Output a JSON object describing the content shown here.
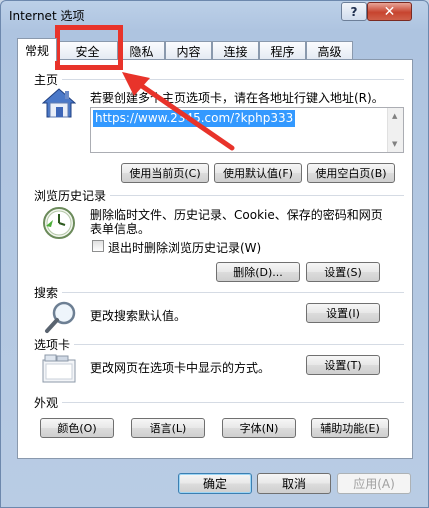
{
  "window": {
    "title": "Internet 选项",
    "help_label": "?",
    "close_label": "✕"
  },
  "tabs": [
    {
      "label": "常规"
    },
    {
      "label": "安全"
    },
    {
      "label": "隐私"
    },
    {
      "label": "内容"
    },
    {
      "label": "连接"
    },
    {
      "label": "程序"
    },
    {
      "label": "高级"
    }
  ],
  "home": {
    "section": "主页",
    "description": "若要创建多个主页选项卡，请在各地址行键入地址(R)。",
    "url": "https://www.2345.com/?kphp333",
    "buttons": [
      "使用当前页(C)",
      "使用默认值(F)",
      "使用空白页(B)"
    ]
  },
  "history": {
    "section": "浏览历史记录",
    "description_line1": "删除临时文件、历史记录、Cookie、保存的密码和网页",
    "description_line2": "表单信息。",
    "checkbox_label": "退出时删除浏览历史记录(W)",
    "delete_button": "删除(D)...",
    "settings_button": "设置(S)"
  },
  "search": {
    "section": "搜索",
    "description": "更改搜索默认值。",
    "settings_button": "设置(I)"
  },
  "tabs_section": {
    "section": "选项卡",
    "description": "更改网页在选项卡中显示的方式。",
    "settings_button": "设置(T)"
  },
  "appearance": {
    "section": "外观",
    "buttons": [
      "颜色(O)",
      "语言(L)",
      "字体(N)",
      "辅助功能(E)"
    ]
  },
  "footer": {
    "ok": "确定",
    "cancel": "取消",
    "apply": "应用(A)"
  },
  "annotation": {
    "color": "#e8332a"
  }
}
